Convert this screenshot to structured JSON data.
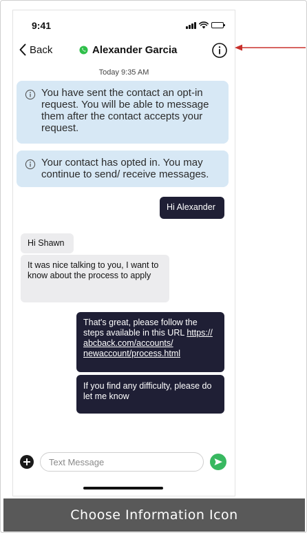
{
  "status_bar": {
    "time": "9:41"
  },
  "nav": {
    "back_label": "Back",
    "contact_name": "Alexander Garcia"
  },
  "conversation": {
    "timestamp": "Today 9:35 AM",
    "system_messages": [
      "You have sent the contact an opt-in request. You will be able to message them after the contact accepts your request.",
      "Your contact has opted in. You may continue to send/ receive messages."
    ],
    "messages": [
      {
        "direction": "outgoing",
        "text": "Hi Alexander"
      },
      {
        "direction": "incoming",
        "text": "Hi Shawn"
      },
      {
        "direction": "incoming",
        "text": "It was nice talking to you, I want to know about the process to apply"
      },
      {
        "direction": "outgoing",
        "text": "That's great, please follow the steps available in this URL",
        "link": "https:// abcback.com/accounts/ newaccount/process.html"
      },
      {
        "direction": "outgoing",
        "text": "If you find any difficulty, please do let me know"
      }
    ]
  },
  "composer": {
    "placeholder": "Text Message"
  },
  "caption": "Choose Information Icon",
  "colors": {
    "annotation_arrow": "#c8302c",
    "whatsapp_green": "#2fbf4a",
    "send_green": "#38b860",
    "system_bubble": "#d7e8f5",
    "outgoing_bubble": "#1f1f35",
    "incoming_bubble": "#ececee",
    "caption_background": "#595959"
  },
  "icons": {
    "back": "chevron-left-icon",
    "contact_channel": "whatsapp-icon",
    "info": "info-circle-icon",
    "add": "plus-circle-icon",
    "send": "send-arrow-icon",
    "annotation": "red-arrow-icon"
  }
}
